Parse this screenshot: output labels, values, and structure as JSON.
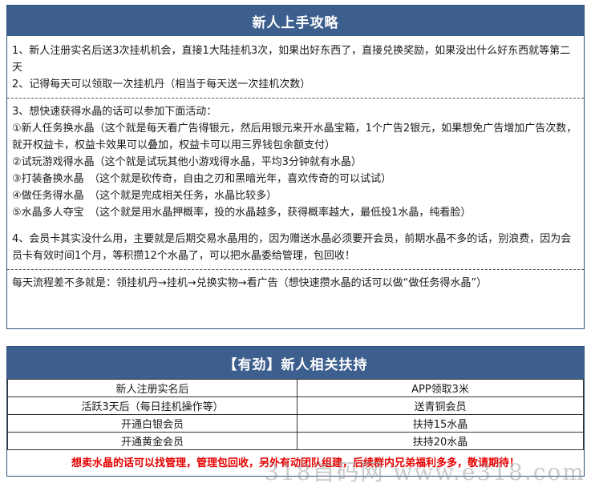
{
  "guide": {
    "title": "新人上手攻略",
    "p1": "1、新人注册实名后送3次挂机机会，直接1大陆挂机3次，如果出好东西了，直接兑换奖励，如果没出什么好东西就等第二天",
    "p2": "2、记得每天可以领取一次挂机丹（相当于每天送一次挂机次数）",
    "p3": "3、想快速获得水晶的话可以参加下面活动：",
    "a1": "①新人任务换水晶（这个就是每天看广告得银元，然后用银元来开水晶宝箱，1个广告2银元，如果想免广告增加广告次数，就开权益卡，权益卡效果可以叠加，权益卡可以用三界钱包余额支付）",
    "a2": "②试玩游戏得水晶（这个就是试玩其他小游戏得水晶，平均3分钟就有水晶）",
    "a3": "③打装备换水晶　（这个就是砍传奇，自由之刃和黑暗光年，喜欢传奇的可以试试）",
    "a4": "④做任务得水晶　（这个就是完成相关任务，水晶比较多）",
    "a5": "⑤水晶多人夺宝　（这个就是用水晶押概率，投的水晶越多，获得概率越大，最低投1水晶，纯看脸）",
    "p4": "4、会员卡其实没什么用，主要就是后期交易水晶用的，因为赠送水晶必须要开会员，前期水晶不多的话，别浪费，因为会员卡有效时间1个月，等积攒12个水晶了，可以把水晶委给管理，包回收！",
    "p5": "每天流程差不多就是：领挂机丹→挂机→兑换实物→看广告（想快速攒水晶的话可以做“做任务得水晶”）"
  },
  "support": {
    "title": "【有劲】新人相关扶持",
    "rows": [
      {
        "left": "新人注册实名后",
        "right": "APP领取3米"
      },
      {
        "left": "活跃3天后（每日挂机操作等）",
        "right": "送青铜会员"
      },
      {
        "left": "开通白银会员",
        "right": "扶持15水晶"
      },
      {
        "left": "开通黄金会员",
        "right": "扶持20水晶"
      }
    ],
    "note": "想卖水晶的话可以找管理，管理包回收，另外有动团队组建，后续群内兄弟福利多多，敬请期待！"
  },
  "watermark": "318首码网 www.e318.com",
  "colors": {
    "header_bg": "#3d5f8e",
    "note_red": "#e60000"
  }
}
